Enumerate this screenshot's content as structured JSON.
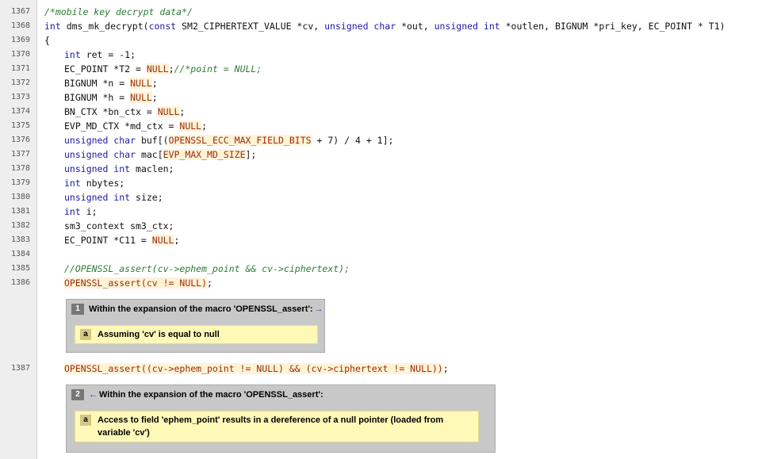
{
  "lines": [
    {
      "num": "1367"
    },
    {
      "num": "1368"
    },
    {
      "num": "1369"
    },
    {
      "num": "1370"
    },
    {
      "num": "1371"
    },
    {
      "num": "1372"
    },
    {
      "num": "1373"
    },
    {
      "num": "1374"
    },
    {
      "num": "1375"
    },
    {
      "num": "1376"
    },
    {
      "num": "1377"
    },
    {
      "num": "1378"
    },
    {
      "num": "1379"
    },
    {
      "num": "1380"
    },
    {
      "num": "1381"
    },
    {
      "num": "1382"
    },
    {
      "num": "1383"
    },
    {
      "num": "1384"
    },
    {
      "num": "1385"
    },
    {
      "num": "1386"
    },
    {
      "num": "1387"
    }
  ],
  "code": {
    "l1367": "/*mobile key decrypt data*/",
    "l1368": {
      "a": "int",
      "b": " dms_mk_decrypt(",
      "c": "const",
      "d": " SM2_CIPHERTEXT_VALUE *cv, ",
      "e": "unsigned char",
      "f": " *out, ",
      "g": "unsigned int",
      "h": " *outlen, BIGNUM *pri_key, EC_POINT * T1)"
    },
    "l1369": "{",
    "l1370": {
      "a": "int",
      "b": " ret = -1;"
    },
    "l1371": {
      "a": "EC_POINT *T2 = ",
      "b": "NULL",
      "c": ";",
      "d": "//*point = NULL;"
    },
    "l1372": {
      "a": "BIGNUM *n = ",
      "b": "NULL",
      "c": ";"
    },
    "l1373": {
      "a": "BIGNUM *h = ",
      "b": "NULL",
      "c": ";"
    },
    "l1374": {
      "a": "BN_CTX *bn_ctx = ",
      "b": "NULL",
      "c": ";"
    },
    "l1375": {
      "a": "EVP_MD_CTX *md_ctx = ",
      "b": "NULL",
      "c": ";"
    },
    "l1376": {
      "a": "unsigned char",
      "b": " buf[(",
      "c": "OPENSSL_ECC_MAX_FIELD_BITS",
      "d": " + 7) / 4 + 1];"
    },
    "l1377": {
      "a": "unsigned char",
      "b": " mac[",
      "c": "EVP_MAX_MD_SIZE",
      "d": "];"
    },
    "l1378": {
      "a": "unsigned int",
      "b": " maclen;"
    },
    "l1379": {
      "a": "int",
      "b": " nbytes;"
    },
    "l1380": {
      "a": "unsigned int",
      "b": " size;"
    },
    "l1381": {
      "a": "int",
      "b": " i;"
    },
    "l1382": "sm3_context sm3_ctx;",
    "l1383": {
      "a": "EC_POINT *C11 = ",
      "b": "NULL",
      "c": ";"
    },
    "l1385": "//OPENSSL_assert(cv->ephem_point && cv->ciphertext);",
    "l1386": {
      "a": "OPENSSL_assert(cv != NULL)",
      "b": ";"
    },
    "l1387": {
      "a": "OPENSSL_assert((cv->ephem_point != NULL) && (cv->ciphertext != NULL))",
      "b": ";"
    }
  },
  "events": [
    {
      "num": "1",
      "title": "Within the expansion of the macro 'OPENSSL_assert':",
      "arrow": "→",
      "note": {
        "tag": "a",
        "text": "Assuming 'cv' is equal to null"
      }
    },
    {
      "num": "2",
      "arrow": "←",
      "title": "Within the expansion of the macro 'OPENSSL_assert':",
      "note": {
        "tag": "a",
        "text": "Access to field 'ephem_point' results in a dereference of a null pointer (loaded from variable 'cv')"
      }
    }
  ],
  "colors": {
    "keyword": "#1a1aa6",
    "comment": "#2e7d32",
    "macro_bg": "#fff3d6",
    "note_bg": "#fff9b8",
    "event_bg": "#c8c8c8"
  }
}
